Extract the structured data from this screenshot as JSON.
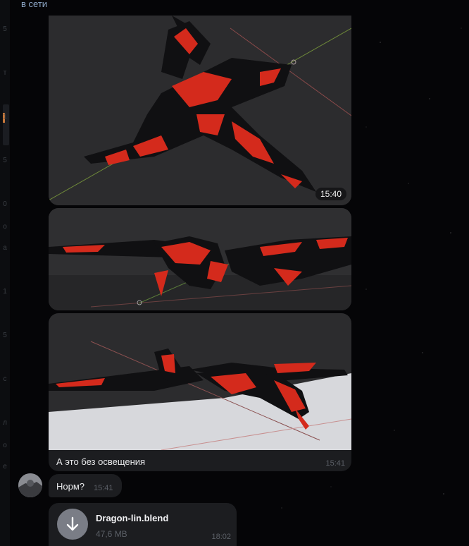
{
  "chat": {
    "status": "в сети",
    "messages": [
      {
        "type": "photo",
        "time": "15:40"
      },
      {
        "type": "photo"
      },
      {
        "type": "photo",
        "caption": "А это без освещения",
        "time": "15:41"
      },
      {
        "type": "text",
        "text": "Норм?",
        "time": "15:41"
      },
      {
        "type": "file",
        "name": "Dragon-lin.blend",
        "size": "47,6 MB",
        "time": "18:02",
        "icon": "download-icon"
      }
    ]
  },
  "left_strip": {
    "marks": [
      "5",
      "т",
      "1",
      "5",
      "0",
      "о",
      "а",
      "1",
      "5",
      "с",
      "л",
      "о",
      "е"
    ]
  },
  "colors": {
    "background": "#050507",
    "bubble": "#1c1d20",
    "status": "#8fa9c9",
    "model_red": "#d42a1c",
    "model_dark": "#101012"
  }
}
